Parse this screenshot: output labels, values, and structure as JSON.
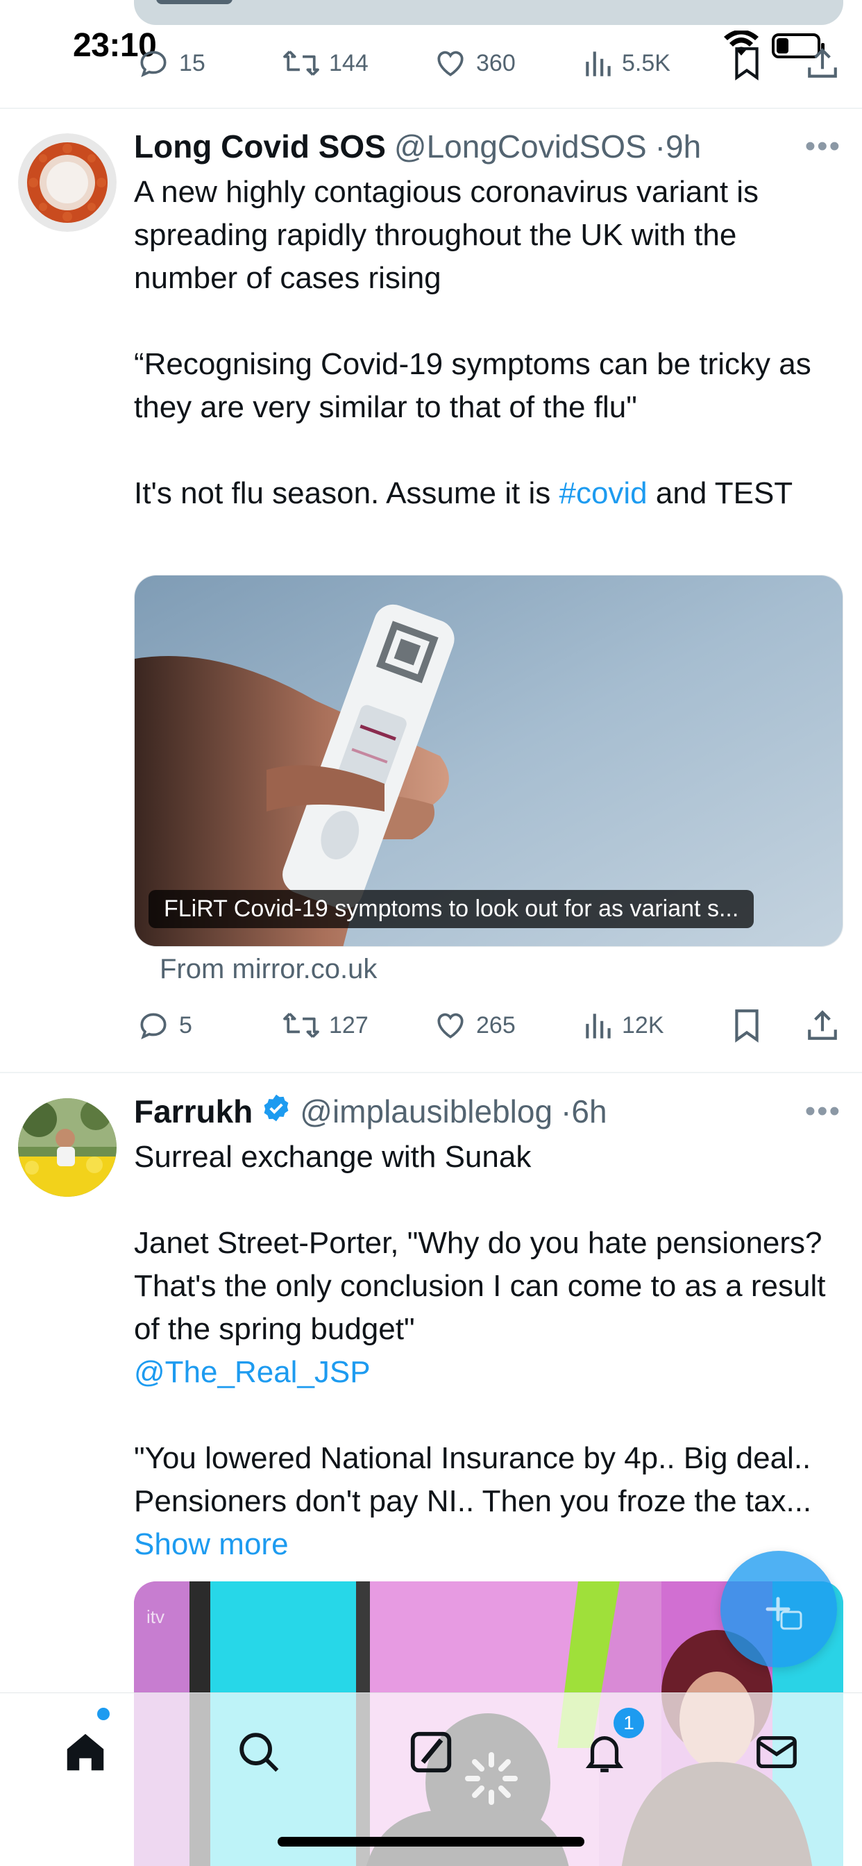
{
  "status_bar": {
    "time": "23:10",
    "battery_level": 0.3
  },
  "previous_tweet": {
    "actions": {
      "replies": "15",
      "retweets": "144",
      "likes": "360",
      "views": "5.5K"
    }
  },
  "tweets": [
    {
      "name": "Long Covid SOS",
      "handle": "@LongCovidSOS",
      "time": "9h",
      "verified": false,
      "text_lines": [
        "A new highly contagious coronavirus variant is spreading rapidly throughout the UK with the number of cases rising",
        "“Recognising Covid-19 symptoms can be tricky as they are very similar to that of the flu\"",
        "It's not flu season. Assume it is "
      ],
      "hashtag": "#covid",
      "text_tail": " and TEST",
      "card": {
        "caption": "FLiRT Covid-19 symptoms to look out for as variant s...",
        "source": "From mirror.co.uk"
      },
      "actions": {
        "replies": "5",
        "retweets": "127",
        "likes": "265",
        "views": "12K"
      }
    },
    {
      "name": "Farrukh",
      "handle": "@implausibleblog",
      "time": "6h",
      "verified": true,
      "text_lines": [
        "Surreal exchange with Sunak",
        "Janet Street-Porter, \"Why do you hate pensioners? That's the only conclusion I can come to as a result of the spring budget\"",
        "@The_Real_JSP",
        "\"You lowered National Insurance by 4p.. Big deal.. Pensioners don't pay NI.. Then you froze the tax... "
      ],
      "show_more": "Show more",
      "media_watermark": "itv"
    }
  ],
  "tab_bar": {
    "items": [
      "home",
      "search",
      "grok",
      "notifications",
      "messages"
    ],
    "notification_count": "1"
  },
  "colors": {
    "accent": "#1d9bf0",
    "text": "#0f1419",
    "secondary": "#536471"
  }
}
